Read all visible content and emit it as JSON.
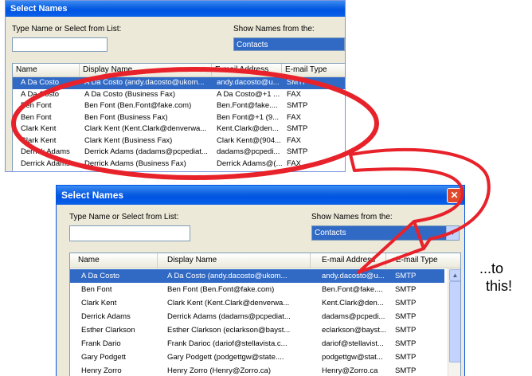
{
  "dialog_old": {
    "title": "Select Names",
    "type_name_label": "Type Name or Select from List:",
    "show_names_label": "Show Names from the:",
    "show_names_value": "Contacts",
    "columns": [
      "Name",
      "Display Name",
      "E-mail Address",
      "E-mail Type"
    ],
    "rows": [
      {
        "name": "A Da Costo",
        "display": "A Da Costo (andy.dacosto@ukom...",
        "email": "andy.dacosto@u...",
        "type": "SMTP",
        "selected": true
      },
      {
        "name": "A Da Costo",
        "display": "A Da Costo (Business Fax)",
        "email": "A Da Costo@+1 ...",
        "type": "FAX"
      },
      {
        "name": "Ben Font",
        "display": "Ben Font (Ben.Font@fake.com)",
        "email": "Ben.Font@fake....",
        "type": "SMTP"
      },
      {
        "name": "Ben Font",
        "display": "Ben Font (Business Fax)",
        "email": "Ben Font@+1 (9...",
        "type": "FAX"
      },
      {
        "name": "Clark Kent",
        "display": "Clark Kent (Kent.Clark@denverwa...",
        "email": "Kent.Clark@den...",
        "type": "SMTP"
      },
      {
        "name": "Clark Kent",
        "display": "Clark Kent (Business Fax)",
        "email": "Clark Kent@(904...",
        "type": "FAX"
      },
      {
        "name": "Derrick Adams",
        "display": "Derrick Adams (dadams@pcpediat...",
        "email": "dadams@pcpedi...",
        "type": "SMTP"
      },
      {
        "name": "Derrick Adams",
        "display": "Derrick Adams (Business Fax)",
        "email": "Derrick Adams@(...",
        "type": "FAX"
      }
    ]
  },
  "dialog_new": {
    "title": "Select Names",
    "close_glyph": "✕",
    "type_name_label": "Type Name or Select from List:",
    "show_names_label": "Show Names from the:",
    "show_names_value": "Contacts",
    "columns": [
      "Name",
      "Display Name",
      "E-mail Address",
      "E-mail Type"
    ],
    "rows": [
      {
        "name": "A Da Costo",
        "display": "A Da Costo (andy.dacosto@ukom...",
        "email": "andy.dacosto@u...",
        "type": "SMTP",
        "selected": true
      },
      {
        "name": "Ben Font",
        "display": "Ben Font (Ben.Font@fake.com)",
        "email": "Ben.Font@fake....",
        "type": "SMTP"
      },
      {
        "name": "Clark Kent",
        "display": "Clark Kent (Kent.Clark@denverwa...",
        "email": "Kent.Clark@den...",
        "type": "SMTP"
      },
      {
        "name": "Derrick Adams",
        "display": "Derrick Adams (dadams@pcpediat...",
        "email": "dadams@pcpedi...",
        "type": "SMTP"
      },
      {
        "name": "Esther Clarkson",
        "display": "Esther Clarkson (eclarkson@bayst...",
        "email": "eclarkson@bayst...",
        "type": "SMTP"
      },
      {
        "name": "Frank Dario",
        "display": "Frank Darioc (dariof@stellavista.c...",
        "email": "dariof@stellavist...",
        "type": "SMTP"
      },
      {
        "name": "Gary Podgett",
        "display": "Gary Podgett (podgettgw@state....",
        "email": "podgettgw@stat...",
        "type": "SMTP"
      },
      {
        "name": "Henry Zorro",
        "display": "Henry Zorro (Henry@Zorro.ca)",
        "email": "Henry@Zorro.ca",
        "type": "SMTP"
      }
    ]
  },
  "callout": {
    "line1": "...to",
    "line2": "this!"
  },
  "annotation_color": "#e8222a",
  "icons": {
    "scroll_up": "▲",
    "combo_arrow": "▼"
  }
}
